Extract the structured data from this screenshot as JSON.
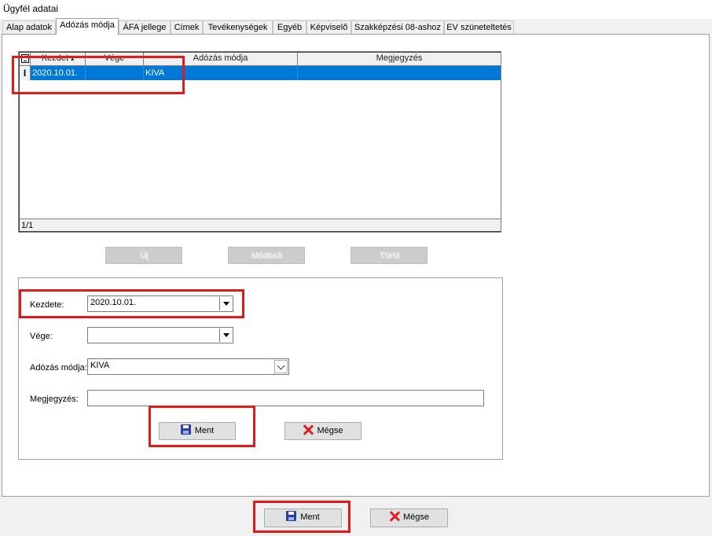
{
  "window": {
    "title": "Ügyfél adatai"
  },
  "tabs": [
    {
      "label": "Alap adatok"
    },
    {
      "label": "Adózás módja"
    },
    {
      "label": "ÁFA jellege"
    },
    {
      "label": "Címek"
    },
    {
      "label": "Tevékenységek"
    },
    {
      "label": "Egyéb"
    },
    {
      "label": "Képviselő"
    },
    {
      "label": "Szakképzési 08-ashoz"
    },
    {
      "label": "EV szüneteltetés"
    }
  ],
  "active_tab": "Adózás módja",
  "grid": {
    "columns": [
      "Kezdet",
      "Vége",
      "Adózás módja",
      "Megjegyzés"
    ],
    "sort_indicator": "▴",
    "row_indicator": "I",
    "rows": [
      {
        "kezdet": "2020.10.01.",
        "vege": "",
        "adozas_modja": "KIVA",
        "megjegyzes": ""
      }
    ],
    "footer": "1/1"
  },
  "grid_buttons": {
    "new": "Új",
    "edit": "Módosít",
    "delete": "Töröl"
  },
  "form": {
    "kezdete_label": "Kezdete:",
    "kezdete_value": "2020.10.01.",
    "vege_label": "Vége:",
    "vege_value": "",
    "adozas_label": "Adózás módja:",
    "adozas_value": "KIVA",
    "megjegyzes_label": "Megjegyzés:",
    "megjegyzes_value": "",
    "save_label": "Ment",
    "cancel_label": "Mégse"
  },
  "bottom": {
    "save_label": "Ment",
    "cancel_label": "Mégse"
  },
  "colors": {
    "selection": "#0078d7",
    "highlight": "#e11a1a",
    "cancel_icon": "#e02020",
    "save_icon": "#2a3fa8"
  },
  "icons": [
    "save-icon",
    "close-x-icon",
    "dropdown-arrow-icon",
    "chevron-down-icon",
    "grid-corner-icon"
  ]
}
